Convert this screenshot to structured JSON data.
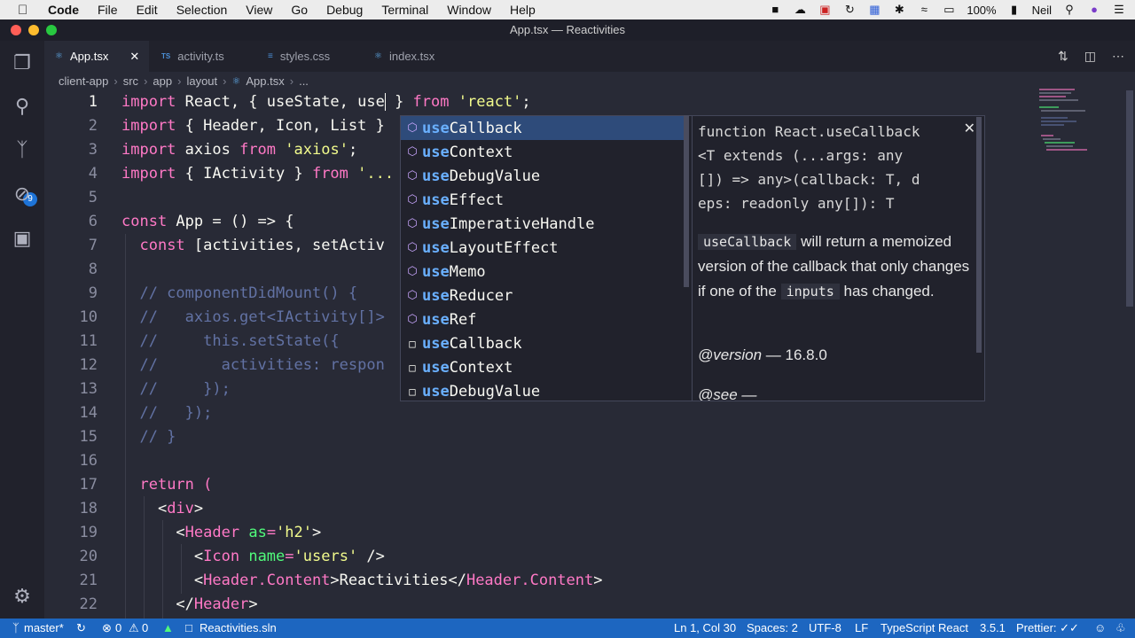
{
  "menubar": {
    "items": [
      "Code",
      "File",
      "Edit",
      "Selection",
      "View",
      "Go",
      "Debug",
      "Terminal",
      "Window",
      "Help"
    ],
    "battery": "100%",
    "user": "Neil"
  },
  "window": {
    "title": "App.tsx — Reactivities"
  },
  "activity_bar": {
    "scm_badge": "9"
  },
  "tabs": [
    {
      "label": "App.tsx",
      "icon": "react-icon",
      "active": true
    },
    {
      "label": "activity.ts",
      "icon": "typescript-icon",
      "active": false
    },
    {
      "label": "styles.css",
      "icon": "css-icon",
      "active": false
    },
    {
      "label": "index.tsx",
      "icon": "react-icon",
      "active": false
    }
  ],
  "breadcrumb": [
    "client-app",
    "src",
    "app",
    "layout",
    "App.tsx",
    "..."
  ],
  "line_numbers": [
    "1",
    "2",
    "3",
    "4",
    "5",
    "6",
    "7",
    "8",
    "9",
    "10",
    "11",
    "12",
    "13",
    "14",
    "15",
    "16",
    "17",
    "18",
    "19",
    "20",
    "21",
    "22"
  ],
  "code": {
    "l1": {
      "a": "import",
      "b": " React, { useState, use",
      "c": " } ",
      "d": "from",
      "e": " ",
      "f": "'react'",
      "g": ";"
    },
    "l2": {
      "a": "import",
      "b": " { Header, Icon, List }"
    },
    "l3": {
      "a": "import",
      "b": " axios ",
      "c": "from",
      "d": " ",
      "e": "'axios'",
      "f": ";"
    },
    "l4": {
      "a": "import",
      "b": " { IActivity } ",
      "c": "from",
      "d": " ",
      "e": "'..."
    },
    "l6": {
      "a": "const",
      "b": " App = () => {"
    },
    "l7": {
      "a": "  ",
      "b": "const",
      "c": " [activities, setActiv"
    },
    "l9": "  // componentDidMount() {",
    "l10": "  //   axios.get<IActivity[]>",
    "l11": "  //     this.setState({",
    "l12": "  //       activities: respon",
    "l13": "  //     });",
    "l14": "  //   });",
    "l15": "  // }",
    "l17": {
      "a": "  ",
      "b": "return",
      "c": " ("
    },
    "l18": {
      "a": "    <",
      "b": "div",
      "c": ">"
    },
    "l19": {
      "a": "      <",
      "b": "Header",
      "c": " ",
      "d": "as",
      "e": "=",
      "f": "'h2'",
      "g": ">"
    },
    "l20": {
      "a": "        <",
      "b": "Icon",
      "c": " ",
      "d": "name",
      "e": "=",
      "f": "'users'",
      "g": " />"
    },
    "l21": {
      "a": "        <",
      "b": "Header.Content",
      "c": ">Reactivities</",
      "d": "Header.Content",
      "e": ">"
    },
    "l22": {
      "a": "      </",
      "b": "Header",
      "c": ">"
    }
  },
  "suggestions": [
    {
      "match": "use",
      "rest": "Callback",
      "kind": "symbol",
      "selected": true
    },
    {
      "match": "use",
      "rest": "Context",
      "kind": "symbol"
    },
    {
      "match": "use",
      "rest": "DebugValue",
      "kind": "symbol"
    },
    {
      "match": "use",
      "rest": "Effect",
      "kind": "symbol"
    },
    {
      "match": "use",
      "rest": "ImperativeHandle",
      "kind": "symbol"
    },
    {
      "match": "use",
      "rest": "LayoutEffect",
      "kind": "symbol"
    },
    {
      "match": "use",
      "rest": "Memo",
      "kind": "symbol"
    },
    {
      "match": "use",
      "rest": "Reducer",
      "kind": "symbol"
    },
    {
      "match": "use",
      "rest": "Ref",
      "kind": "symbol"
    },
    {
      "match": "use",
      "rest": "Callback",
      "kind": "text"
    },
    {
      "match": "use",
      "rest": "Context",
      "kind": "text"
    },
    {
      "match": "use",
      "rest": "DebugValue",
      "kind": "text"
    }
  ],
  "details": {
    "signature": [
      "function React.useCallback",
      "<T extends (...args: any",
      "[]) => any>(callback: T, d",
      "eps: readonly any[]): T"
    ],
    "doc_code1": "useCallback",
    "doc_text1": " will return a memoized version of the callback that only changes if one of the ",
    "doc_code2": "inputs",
    "doc_text2": " has changed.",
    "version_label": "@version",
    "version_value": " — 16.8.0",
    "see": "@see —"
  },
  "statusbar": {
    "branch": "master*",
    "errors": "0",
    "warnings": "0",
    "solution": "Reactivities.sln",
    "position": "Ln 1, Col 30",
    "spaces": "Spaces: 2",
    "encoding": "UTF-8",
    "eol": "LF",
    "language": "TypeScript React",
    "version": "3.5.1",
    "formatter": "Prettier: ✓✓"
  },
  "colors": {
    "accent": "#1d66c0",
    "editor_bg": "#282a36",
    "keyword": "#ff79c6",
    "string": "#f1fa8c",
    "comment": "#6272a4"
  }
}
